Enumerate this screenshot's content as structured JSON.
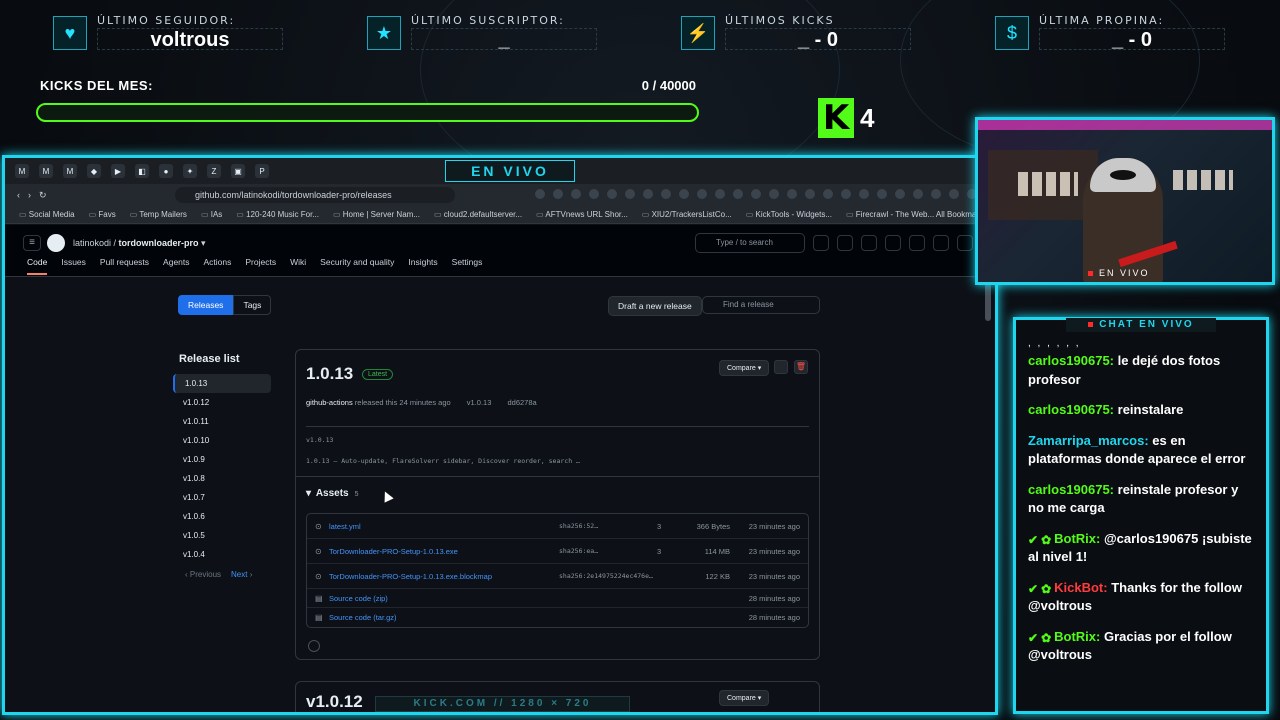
{
  "stats": [
    {
      "icon": "heart-icon",
      "glyph": "♥",
      "label": "ÚLTIMO SEGUIDOR:",
      "value": "voltrous"
    },
    {
      "icon": "star-icon",
      "glyph": "★",
      "label": "ÚLTIMO SUSCRIPTOR:",
      "value": "_"
    },
    {
      "icon": "bolt-icon",
      "glyph": "⚡",
      "label": "ÚLTIMOS KICKS",
      "value": "_ - 0"
    },
    {
      "icon": "dollar-icon",
      "glyph": "$",
      "label": "ÚLTIMA PROPINA:",
      "value": "_ - 0"
    }
  ],
  "kicks": {
    "label": "KICKS DEL MES:",
    "count": "0 / 40000",
    "progress": 0,
    "badge": "K",
    "badge_count": "4"
  },
  "browser": {
    "live_tab": "EN VIVO",
    "url": "github.com/latinokodi/tordownloader-pro/releases",
    "bookmarks": [
      "Social Media",
      "Favs",
      "Temp Mailers",
      "IAs",
      "120-240 Music For...",
      "Home | Server Nam...",
      "cloud2.defaultserver...",
      "AFTVnews URL Shor...",
      "XIU2/TrackersListCo...",
      "KickTools - Widgets...",
      "Firecrawl - The Web..."
    ],
    "all_bookmarks": "All Bookmarks"
  },
  "github": {
    "owner": "latinokodi",
    "repo": "tordownloader-pro",
    "search_placeholder": "Type / to search",
    "tabs": [
      "Code",
      "Issues",
      "Pull requests",
      "Agents",
      "Actions",
      "Projects",
      "Wiki",
      "Security and quality",
      "Insights",
      "Settings"
    ],
    "seg_releases": "Releases",
    "seg_tags": "Tags",
    "draft_button": "Draft a new release",
    "find_placeholder": "Find a release",
    "release_list_title": "Release list",
    "release_list": [
      "1.0.13",
      "v1.0.12",
      "v1.0.11",
      "v1.0.10",
      "v1.0.9",
      "v1.0.8",
      "v1.0.7",
      "v1.0.6",
      "v1.0.5",
      "v1.0.4"
    ],
    "pager_prev": "Previous",
    "pager_next": "Next",
    "release": {
      "version": "1.0.13",
      "latest": "Latest",
      "compare": "Compare",
      "author": "github-actions",
      "released": "released this 24 minutes ago",
      "tag": "v1.0.13",
      "commit": "dd6278a",
      "tagline": "v1.0.13",
      "description": "1.0.13 – Auto-update, FlareSolverr sidebar, Discover reorder, search …",
      "assets_label": "Assets",
      "assets_count": "5",
      "assets": [
        {
          "name": "latest.yml",
          "sha": "sha256:52…",
          "downloads": "3",
          "size": "366 Bytes",
          "time": "23 minutes ago"
        },
        {
          "name": "TorDownloader-PRO-Setup-1.0.13.exe",
          "sha": "sha256:ea…",
          "downloads": "3",
          "size": "114 MB",
          "time": "23 minutes ago"
        },
        {
          "name": "TorDownloader-PRO-Setup-1.0.13.exe.blockmap",
          "sha": "sha256:2e14975224ec476e…",
          "downloads": "",
          "size": "122 KB",
          "time": "23 minutes ago"
        }
      ],
      "sources": [
        {
          "name": "Source code (zip)",
          "time": "28 minutes ago"
        },
        {
          "name": "Source code (tar.gz)",
          "time": "28 minutes ago"
        }
      ]
    },
    "next_release": {
      "version": "v1.0.12",
      "compare": "Compare"
    }
  },
  "watermark": "KICK.COM // 1280 × 720",
  "cam_tag": "EN VIVO",
  "chat": {
    "title": "CHAT EN VIVO",
    "dots": ", , , , , ,",
    "messages": [
      {
        "user": "carlos190675:",
        "text": "le dejé dos fotos profesor",
        "badges": false,
        "color": "green"
      },
      {
        "user": "carlos190675:",
        "text": "reinstalare",
        "badges": false,
        "color": "green"
      },
      {
        "user": "Zamarripa_marcos:",
        "text": "es en plataformas donde aparece el error",
        "badges": false,
        "color": "cyan"
      },
      {
        "user": "carlos190675:",
        "text": "reinstale profesor y no me carga",
        "badges": false,
        "color": "green"
      },
      {
        "user": "BotRix:",
        "text": "@carlos190675 ¡subiste al nivel 1!",
        "badges": true,
        "color": "green"
      },
      {
        "user": "KickBot:",
        "text": "Thanks for the follow @voltrous",
        "badges": true,
        "color": "red"
      },
      {
        "user": "BotRix:",
        "text": "Gracias por el follow @voltrous",
        "badges": true,
        "color": "green"
      }
    ]
  },
  "colors": {
    "accent": "#1fd6ee",
    "kick_green": "#53fc18",
    "gh_link": "#4493f8"
  }
}
